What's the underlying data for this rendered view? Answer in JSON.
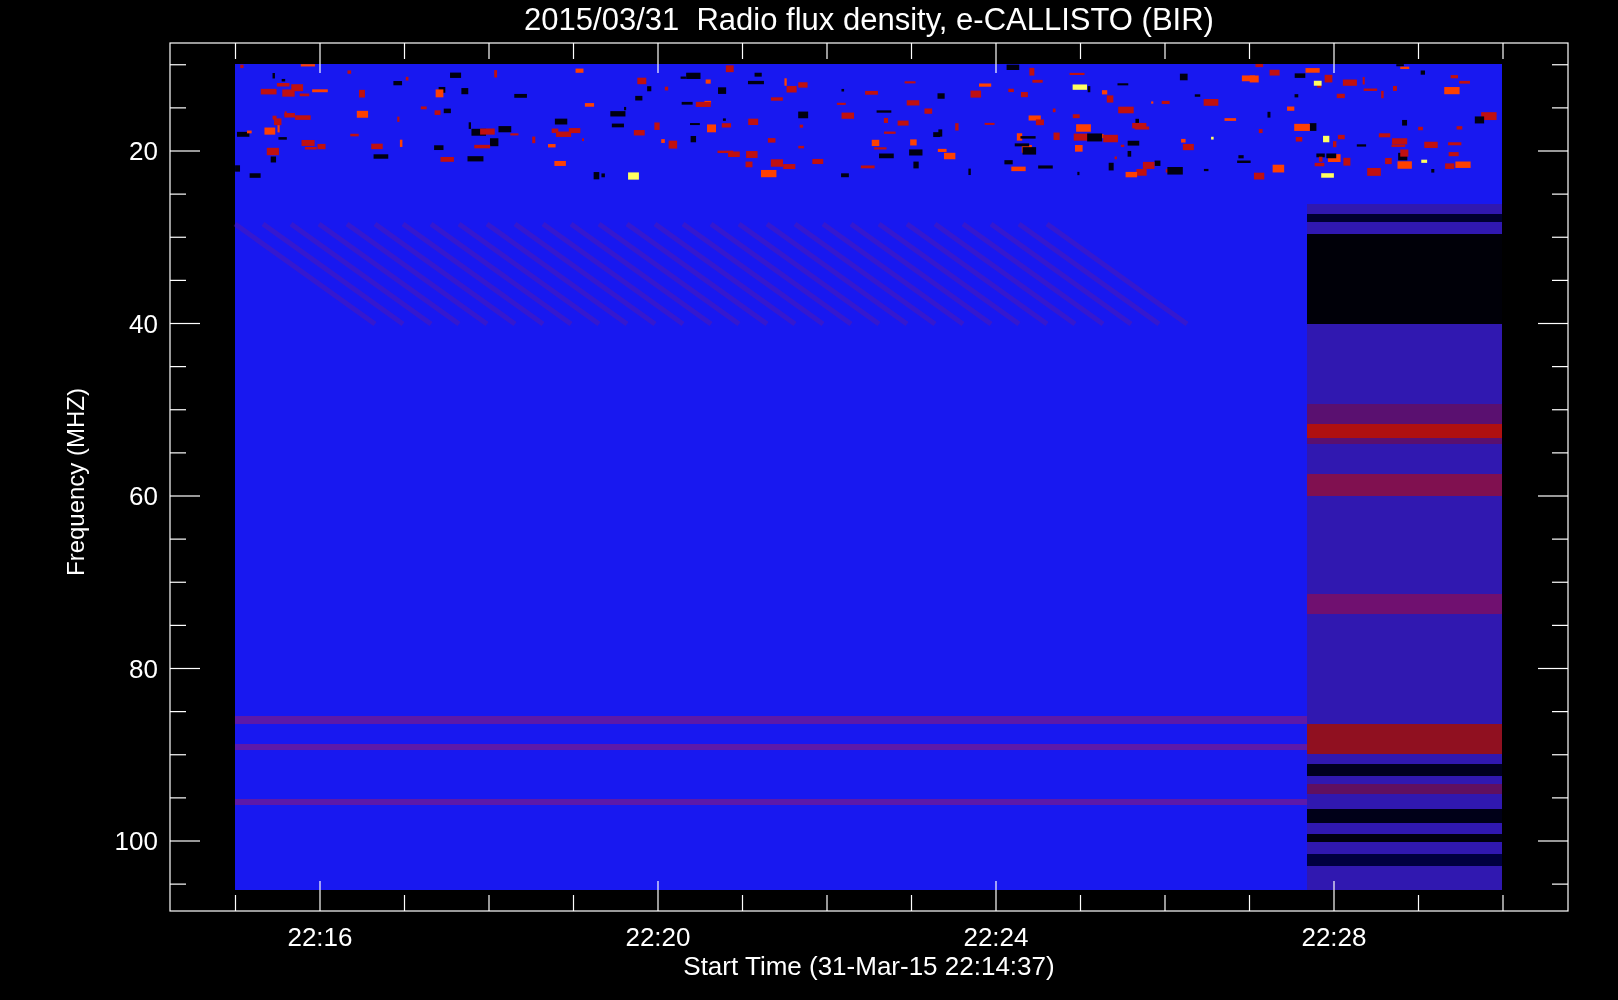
{
  "title": "2015/03/31  Radio flux density, e-CALLISTO (BIR)",
  "y_axis": {
    "label": "Frequency (MHZ)",
    "ticks": [
      "20",
      "40",
      "60",
      "80",
      "100"
    ]
  },
  "x_axis": {
    "label": "Start Time (31-Mar-15 22:14:37)",
    "ticks": [
      "22:16",
      "22:20",
      "22:24",
      "22:28"
    ]
  }
}
